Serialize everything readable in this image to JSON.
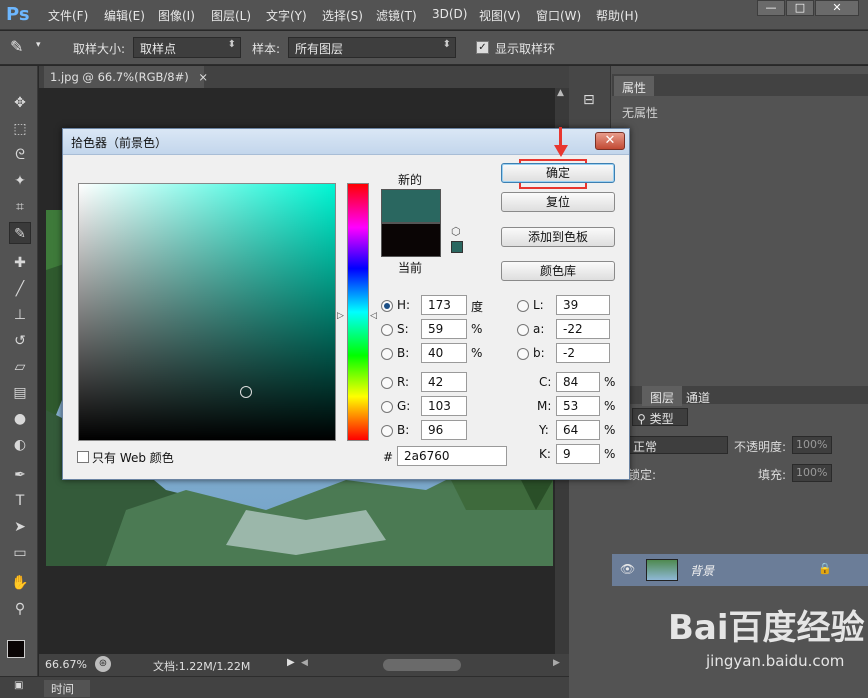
{
  "app": {
    "logo": "Ps",
    "menu": [
      "文件(F)",
      "编辑(E)",
      "图像(I)",
      "图层(L)",
      "文字(Y)",
      "选择(S)",
      "滤镜(T)",
      "3D(D)",
      "视图(V)",
      "窗口(W)",
      "帮助(H)"
    ],
    "window_controls": [
      "—",
      "□",
      "✕"
    ]
  },
  "options_bar": {
    "sample_size_label": "取样大小:",
    "sample_size_value": "取样点",
    "sample_label": "样本:",
    "sample_value": "所有图层",
    "show_ring_label": "显示取样环",
    "show_ring_checked": true
  },
  "document": {
    "tab_title": "1.jpg @ 66.7%(RGB/8#)",
    "tab_close": "×",
    "zoom": "66.67%",
    "doc_info": "文档:1.22M/1.22M"
  },
  "timeline_label": "时间轴",
  "properties_panel": {
    "tab": "属性",
    "content": "无属性"
  },
  "layers_panel": {
    "tabs": [
      "图层",
      "通道"
    ],
    "filter_label": "类型",
    "blend_mode": "正常",
    "opacity_label": "不透明度:",
    "opacity_value": "100%",
    "lock_label": "锁定:",
    "fill_label": "填充:",
    "fill_value": "100%",
    "layers": [
      {
        "name": "背景",
        "visible": true,
        "locked": true
      }
    ]
  },
  "color_picker": {
    "title": "拾色器（前景色）",
    "close": "✕",
    "new_label": "新的",
    "current_label": "当前",
    "new_color": "#2a6760",
    "current_color": "#0a0505",
    "buttons": {
      "ok": "确定",
      "reset": "复位",
      "add_swatch": "添加到色板",
      "color_library": "颜色库"
    },
    "web_only_label": "只有 Web 颜色",
    "web_only_checked": false,
    "hsb": [
      {
        "key": "H:",
        "value": "173",
        "unit": "度",
        "selected": true
      },
      {
        "key": "S:",
        "value": "59",
        "unit": "%",
        "selected": false
      },
      {
        "key": "B:",
        "value": "40",
        "unit": "%",
        "selected": false
      }
    ],
    "rgb": [
      {
        "key": "R:",
        "value": "42"
      },
      {
        "key": "G:",
        "value": "103"
      },
      {
        "key": "B:",
        "value": "96"
      }
    ],
    "lab": [
      {
        "key": "L:",
        "value": "39"
      },
      {
        "key": "a:",
        "value": "-22"
      },
      {
        "key": "b:",
        "value": "-2"
      }
    ],
    "cmyk": [
      {
        "key": "C:",
        "value": "84",
        "unit": "%"
      },
      {
        "key": "M:",
        "value": "53",
        "unit": "%"
      },
      {
        "key": "Y:",
        "value": "64",
        "unit": "%"
      },
      {
        "key": "K:",
        "value": "9",
        "unit": "%"
      }
    ],
    "hex_label": "#",
    "hex_value": "2a6760"
  },
  "watermark": {
    "brand": "Bai百度经验",
    "url": "jingyan.baidu.com"
  }
}
